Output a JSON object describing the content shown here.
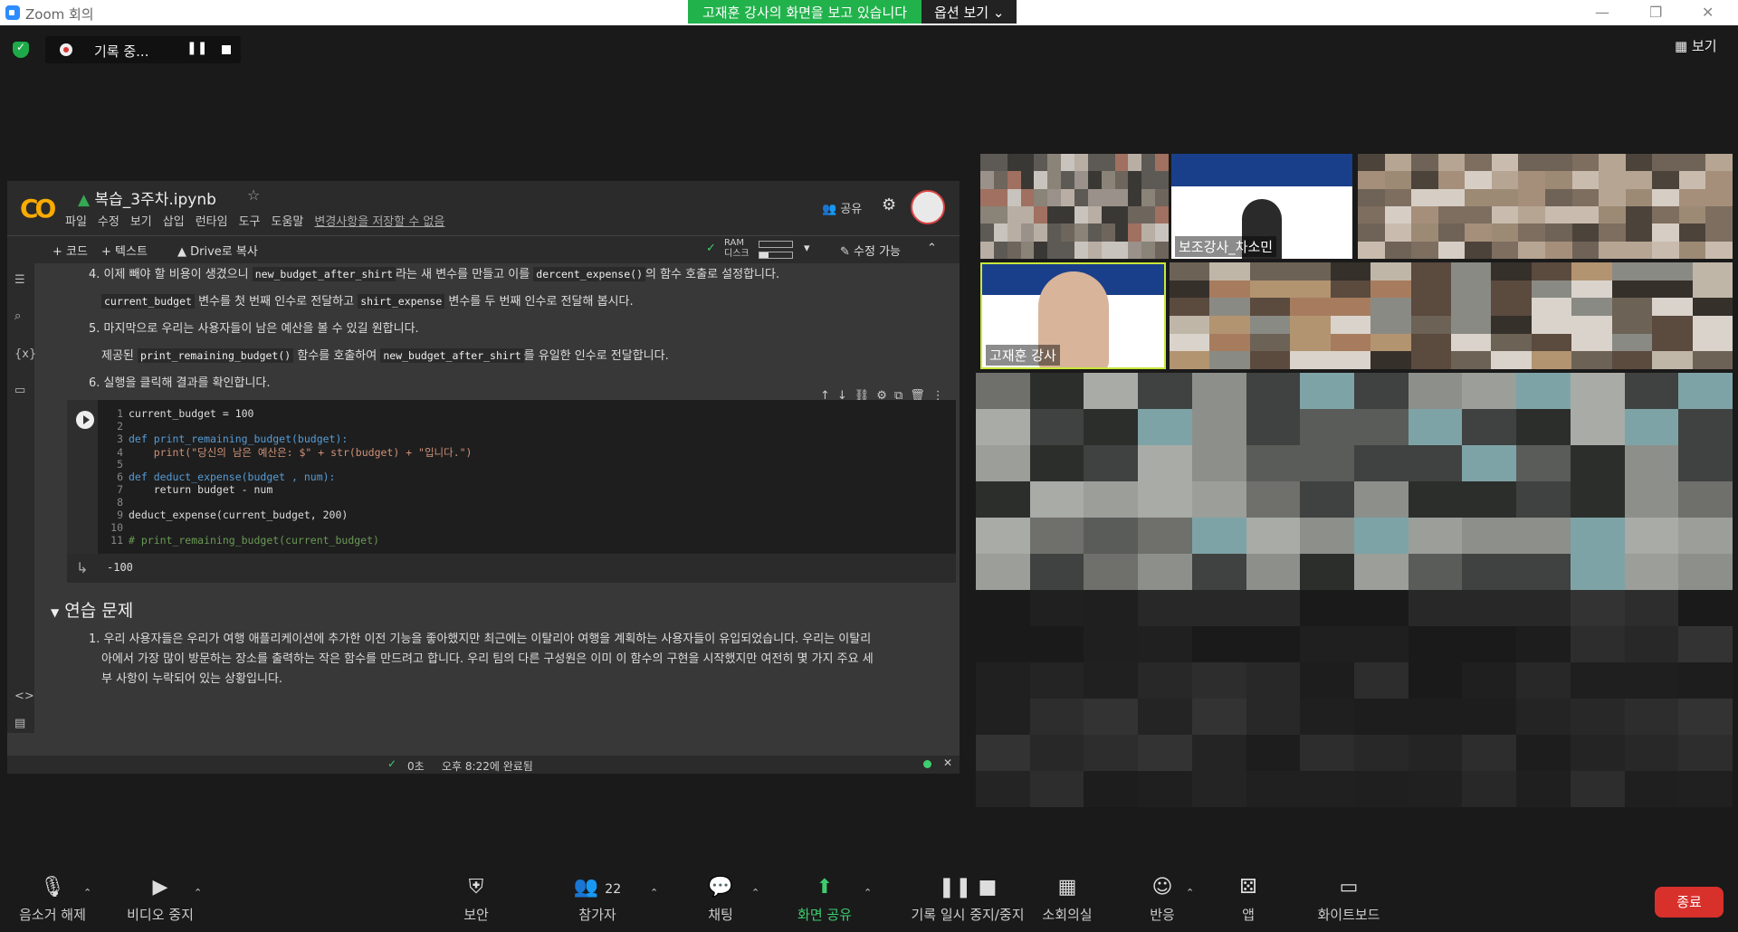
{
  "window": {
    "title": "Zoom 회의"
  },
  "share_banner": {
    "text": "고재훈 강사의 화면을 보고 있습니다",
    "options": "옵션 보기"
  },
  "recording": {
    "label": "기록 중..."
  },
  "view_button": "보기",
  "colab": {
    "filename": "복습_3주차.ipynb",
    "menu": [
      "파일",
      "수정",
      "보기",
      "삽입",
      "런타임",
      "도구",
      "도움말"
    ],
    "unsaved": "변경사항을 저장할 수 없음",
    "share": "공유",
    "toolbar": {
      "code": "+ 코드",
      "text": "+ 텍스트",
      "drive": "Drive로 복사",
      "ram": "RAM",
      "disk": "디스크",
      "edit": "수정 가능"
    },
    "instructions": {
      "l4a": "4. 이제 빼야 할 비용이 생겼으니",
      "l4_code1": "new_budget_after_shirt",
      "l4b": "라는 새 변수를 만들고 이를",
      "l4_code2": "dercent_expense()",
      "l4c": "의 함수 호출로 설정합니다.",
      "l4_code3": "current_budget",
      "l4d": "변수를 첫 번째 인수로 전달하고",
      "l4_code4": "shirt_expense",
      "l4e": "변수를 두 번째 인수로 전달해 봅시다.",
      "l5": "5. 마지막으로 우리는 사용자들이 남은 예산을 볼 수 있길 원합니다.",
      "l5a": "제공된",
      "l5_code1": "print_remaining_budget()",
      "l5b": "함수를 호출하여",
      "l5_code2": "new_budget_after_shirt",
      "l5c": "를 유일한 인수로 전달합니다.",
      "l6": "6. 실행을 클릭해 결과를 확인합니다."
    },
    "code_lines": [
      "current_budget = 100",
      "",
      "def print_remaining_budget(budget):",
      "    print(\"당신의 남은 예산은: $\" + str(budget) + \"입니다.\")",
      "",
      "def deduct_expense(budget , num):",
      "    return budget - num",
      "",
      "deduct_expense(current_budget, 200)",
      "",
      "# print_remaining_budget(current_budget)"
    ],
    "output": "-100",
    "section_title": "연습 문제",
    "exercise": [
      "1. 우리 사용자들은 우리가 여행 애플리케이션에 추가한 이전 기능을 좋아했지만 최근에는 이탈리아 여행을 계획하는 사용자들이 유입되었습니다. 우리는 이탈리",
      "아에서 가장 많이 방문하는 장소를 출력하는 작은 함수를 만드려고 합니다. 우리 팀의 다른 구성원은 이미 이 함수의 구현을 시작했지만 여전히 몇 가지 주요 세",
      "부 사항이 누락되어 있는 상황입니다."
    ],
    "status": {
      "check": "0초",
      "time": "오후 8:22에 완료됨"
    }
  },
  "participants_tiles": {
    "assistant": "보조강사_차소민",
    "host": "고재훈 강사"
  },
  "bottom_bar": {
    "mute": "음소거 해제",
    "video": "비디오 중지",
    "security": "보안",
    "participants": "참가자",
    "participants_count": "22",
    "chat": "채팅",
    "share": "화면 공유",
    "record": "기록 일시 중지/중지",
    "breakout": "소회의실",
    "reactions": "반응",
    "apps": "앱",
    "whiteboard": "화이트보드",
    "end": "종료"
  }
}
